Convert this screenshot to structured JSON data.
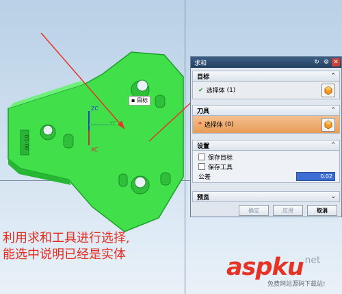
{
  "dialog": {
    "title": "求和",
    "sections": {
      "target": {
        "header": "目标",
        "select_label": "选择体",
        "select_count": "(1)"
      },
      "tool": {
        "header": "刀具",
        "select_label": "选择体",
        "select_count": "(0)"
      },
      "settings": {
        "header": "设置",
        "keep_target_label": "保存目标",
        "keep_tool_label": "保存工具",
        "tolerance_label": "公差",
        "tolerance_value": "0.02"
      },
      "preview": {
        "header": "预览"
      }
    },
    "buttons": {
      "ok": "确定",
      "apply": "应用",
      "cancel": "取消"
    }
  },
  "viewport": {
    "hover_label": "目标",
    "axes": {
      "z": "ZC",
      "y": "YC",
      "x": "XC"
    },
    "part_engraving": "01-00"
  },
  "annotation": {
    "line1": "利用求和工具进行选择,",
    "line2": "能选中说明已经是实体"
  },
  "watermark": {
    "brand": "aspku",
    "suffix": ".net",
    "tagline": "免费网站源码下载站!"
  },
  "colors": {
    "part_fill": "#3fe04a",
    "arrow": "#e53325",
    "title_bar": "#2f4f72",
    "active_row": "#eca565"
  }
}
